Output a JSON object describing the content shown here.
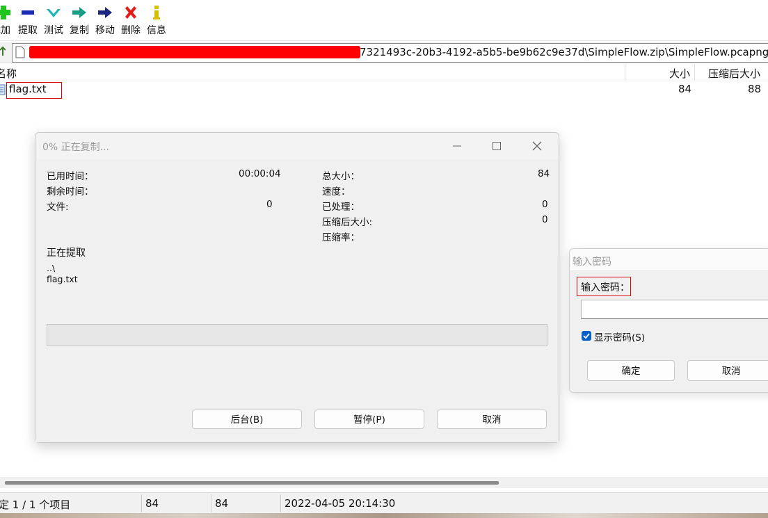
{
  "toolbar": {
    "buttons": [
      {
        "label": "添加",
        "icon": "plus-icon",
        "color": "#1fc41f"
      },
      {
        "label": "提取",
        "icon": "minus-icon",
        "color": "#1a2bb8"
      },
      {
        "label": "测试",
        "icon": "check-icon",
        "color": "#1bb6b6"
      },
      {
        "label": "复制",
        "icon": "copy-arrow-icon",
        "color": "#1a9c86"
      },
      {
        "label": "移动",
        "icon": "move-arrow-icon",
        "color": "#1a2580"
      },
      {
        "label": "删除",
        "icon": "delete-x-icon",
        "color": "#e21b1b"
      },
      {
        "label": "信息",
        "icon": "info-icon",
        "color": "#d4c000"
      }
    ]
  },
  "address": {
    "path_visible": "7321493c-20b3-4192-a5b5-be9b62c9e37d\\SimpleFlow.zip\\SimpleFlow.pcapng\\"
  },
  "list": {
    "headers": {
      "name": "名称",
      "size": "大小",
      "packed": "压缩后大小"
    },
    "rows": [
      {
        "name": "flag.txt",
        "size": "84",
        "packed": "88"
      }
    ]
  },
  "copy_dialog": {
    "title": "0% 正在复制...",
    "elapsed_label": "已用时间：",
    "elapsed_value": "00:00:04",
    "remaining_label": "剩余时间：",
    "files_label": "文件:",
    "files_value": "0",
    "total_label": "总大小：",
    "total_value": "84",
    "speed_label": "速度：",
    "processed_label": "已处理：",
    "processed_value": "0",
    "packed_label": "压缩后大小:",
    "packed_value": "0",
    "ratio_label": "压缩率：",
    "extracting_label": "正在提取",
    "current_dir": "..\\",
    "current_file": "flag.txt",
    "progress": 0,
    "buttons": {
      "background": "后台(B)",
      "pause": "暂停(P)",
      "cancel": "取消"
    }
  },
  "password_dialog": {
    "title": "输入密码",
    "prompt": "输入密码：",
    "value": "",
    "show_password_label": "显示密码(S)",
    "show_password_checked": true,
    "ok": "确定",
    "cancel": "取消"
  },
  "statusbar": {
    "selection": "定 1 / 1 个项目",
    "size": "84",
    "packed": "84",
    "modified": "2022-04-05 20:14:30"
  }
}
